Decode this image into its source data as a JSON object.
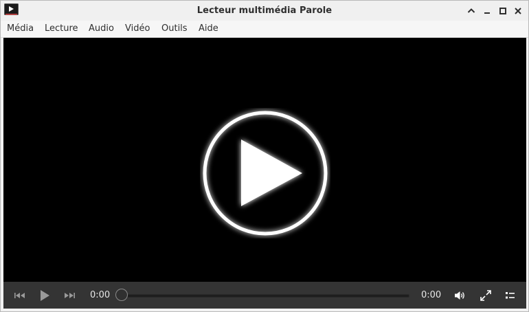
{
  "window": {
    "title": "Lecteur multimédia Parole"
  },
  "menu": {
    "items": [
      "Média",
      "Lecture",
      "Audio",
      "Vidéo",
      "Outils",
      "Aide"
    ]
  },
  "controls": {
    "elapsed_time": "0:00",
    "total_time": "0:00",
    "seek_progress": 0
  },
  "icons": {
    "app": "parole-app-icon",
    "window_buttons": [
      "keep-above-icon",
      "minimize-icon",
      "maximize-icon",
      "close-icon"
    ],
    "transport": [
      "previous-track-icon",
      "play-icon",
      "next-track-icon"
    ],
    "right": [
      "volume-icon",
      "fullscreen-icon",
      "playlist-icon"
    ],
    "overlay": "big-play-icon"
  },
  "colors": {
    "video_background": "#000000",
    "control_bar": "#343434",
    "overlay_icon": "#ffffff"
  }
}
